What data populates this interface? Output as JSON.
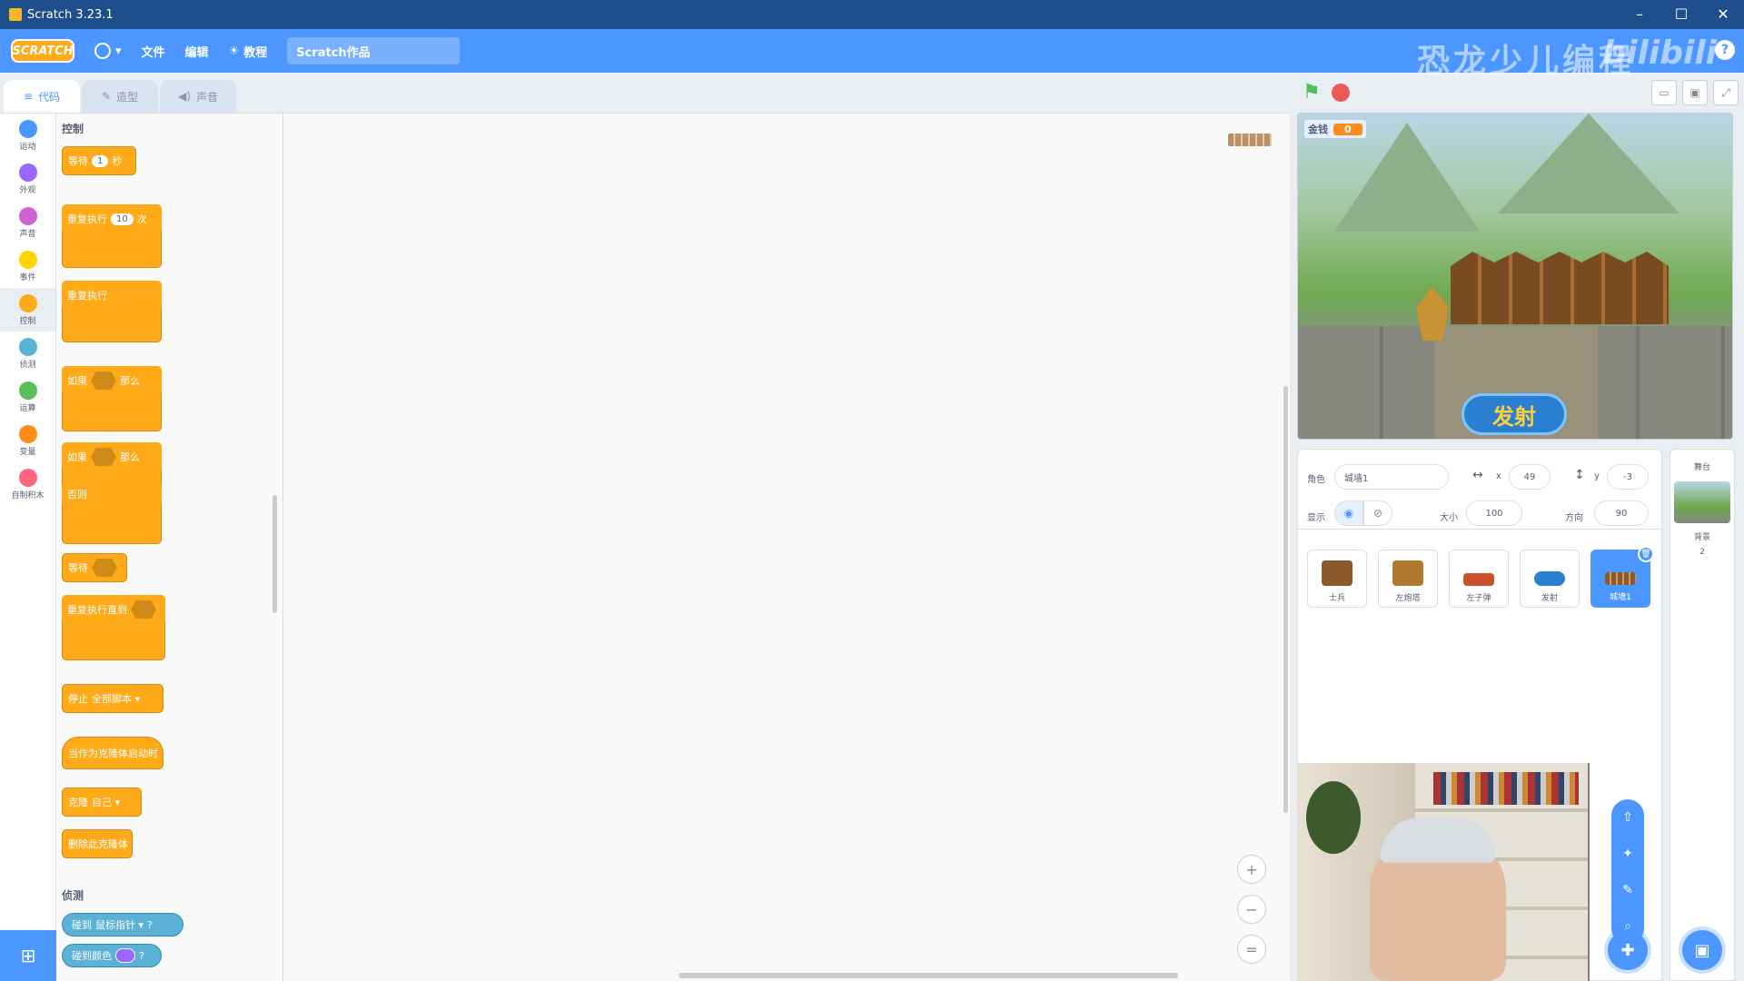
{
  "window": {
    "title": "Scratch 3.23.1",
    "minimize": "–",
    "maximize": "☐",
    "close": "✕"
  },
  "menubar": {
    "logo": "SCRATCH",
    "language_arrow": "▾",
    "file": "文件",
    "edit": "编辑",
    "tutorials": "教程",
    "project_title": "Scratch作品",
    "watermark": "恐龙少儿编程",
    "watermark2": "bilibili",
    "help": "?"
  },
  "tabs": {
    "code": "代码",
    "costumes": "造型",
    "sounds": "声音"
  },
  "categories": [
    {
      "label": "运动",
      "color": "#4c97ff"
    },
    {
      "label": "外观",
      "color": "#9966ff"
    },
    {
      "label": "声音",
      "color": "#cf63cf"
    },
    {
      "label": "事件",
      "color": "#ffd500"
    },
    {
      "label": "控制",
      "color": "#ffab19"
    },
    {
      "label": "侦测",
      "color": "#5cb1d6"
    },
    {
      "label": "运算",
      "color": "#59c059"
    },
    {
      "label": "变量",
      "color": "#ff8c1a"
    },
    {
      "label": "自制积木",
      "color": "#ff6680"
    }
  ],
  "palette": {
    "control_heading": "控制",
    "wait": {
      "label": "等待",
      "value": "1",
      "unit": "秒"
    },
    "repeat": {
      "label": "重复执行",
      "value": "10",
      "unit": "次"
    },
    "forever": "重复执行",
    "if_then": {
      "if": "如果",
      "then": "那么"
    },
    "if_else": {
      "if": "如果",
      "then": "那么",
      "else": "否则"
    },
    "wait_until": "等待",
    "repeat_until": "重复执行直到",
    "stop": {
      "label": "停止",
      "option": "全部脚本 ▾"
    },
    "when_clone": "当作为克隆体启动时",
    "create_clone": {
      "label": "克隆",
      "option": "自己 ▾"
    },
    "delete_clone": "删除此克隆体",
    "sensing_heading": "侦测",
    "touching": {
      "label": "碰到",
      "option": "鼠标指针 ▾",
      "q": "?"
    },
    "touching_color": {
      "label": "碰到颜色",
      "q": "?"
    }
  },
  "zoom": {
    "in": "+",
    "out": "−",
    "reset": "="
  },
  "stage_monitor": {
    "label": "金钱",
    "value": "0"
  },
  "stage_button_text": "发射",
  "sprite_info": {
    "sprite_label": "角色",
    "sprite_name": "城墙1",
    "x_label": "x",
    "x_value": "49",
    "y_label": "y",
    "y_value": "-3",
    "show_label": "显示",
    "size_label": "大小",
    "size_value": "100",
    "direction_label": "方向",
    "direction_value": "90"
  },
  "sprites": [
    {
      "name": "士兵",
      "color": "#8a5a2a"
    },
    {
      "name": "左炮塔",
      "color": "#b07a2c"
    },
    {
      "name": "左子弹",
      "color": "#c9502a"
    },
    {
      "name": "发射",
      "color": "#2a7fd1"
    },
    {
      "name": "城墙1",
      "color": "#8a5a2a"
    }
  ],
  "stage_panel": {
    "label": "舞台",
    "backdrops_label": "背景",
    "backdrops_count": "2"
  }
}
